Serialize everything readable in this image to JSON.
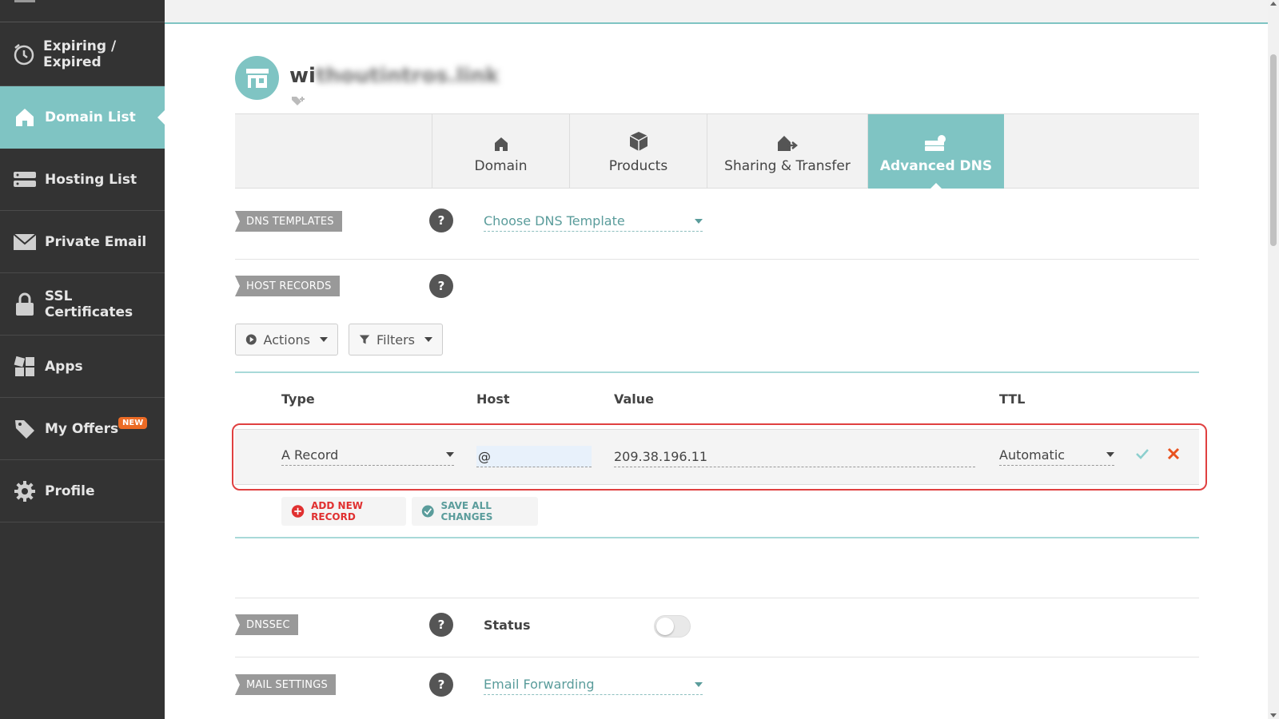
{
  "sidebar": {
    "items": [
      {
        "label": "Expiring / Expired",
        "icon": "clock-icon"
      },
      {
        "label": "Domain List",
        "icon": "house-icon",
        "active": true
      },
      {
        "label": "Hosting List",
        "icon": "server-icon"
      },
      {
        "label": "Private Email",
        "icon": "envelope-icon"
      },
      {
        "label": "SSL Certificates",
        "icon": "lock-icon"
      },
      {
        "label": "Apps",
        "icon": "apps-grid-icon"
      },
      {
        "label": "My Offers",
        "icon": "tag-icon",
        "badge": "NEW"
      },
      {
        "label": "Profile",
        "icon": "gear-icon"
      }
    ]
  },
  "domain": {
    "name_visible": "wi",
    "name_blurred": "thoutintros.link"
  },
  "tabs": [
    {
      "label": "Domain",
      "icon": "house-icon"
    },
    {
      "label": "Products",
      "icon": "box-icon"
    },
    {
      "label": "Sharing & Transfer",
      "icon": "share-house-icon"
    },
    {
      "label": "Advanced DNS",
      "icon": "dns-server-icon",
      "active": true
    }
  ],
  "sections": {
    "dns_templates": {
      "label": "DNS TEMPLATES",
      "select_value": "Choose DNS Template"
    },
    "host_records": {
      "label": "HOST RECORDS"
    },
    "dnssec": {
      "label": "DNSSEC",
      "status_label": "Status",
      "enabled": false
    },
    "mail_settings": {
      "label": "MAIL SETTINGS",
      "select_value": "Email Forwarding"
    }
  },
  "help_glyph": "?",
  "toolbar": {
    "actions_label": "Actions",
    "filters_label": "Filters"
  },
  "table": {
    "headers": {
      "type": "Type",
      "host": "Host",
      "value": "Value",
      "ttl": "TTL"
    },
    "edit_row": {
      "type": "A Record",
      "host": "@",
      "value": "209.38.196.11",
      "ttl": "Automatic"
    }
  },
  "row_actions": {
    "add_label": "ADD NEW RECORD",
    "save_label": "SAVE ALL CHANGES"
  },
  "colors": {
    "sidebar_bg": "#333333",
    "accent_teal": "#7fc4c3",
    "badge_orange": "#ec6b25",
    "add_red": "#e03030",
    "save_teal": "#5a9c9b",
    "highlight_red": "#e04040"
  }
}
